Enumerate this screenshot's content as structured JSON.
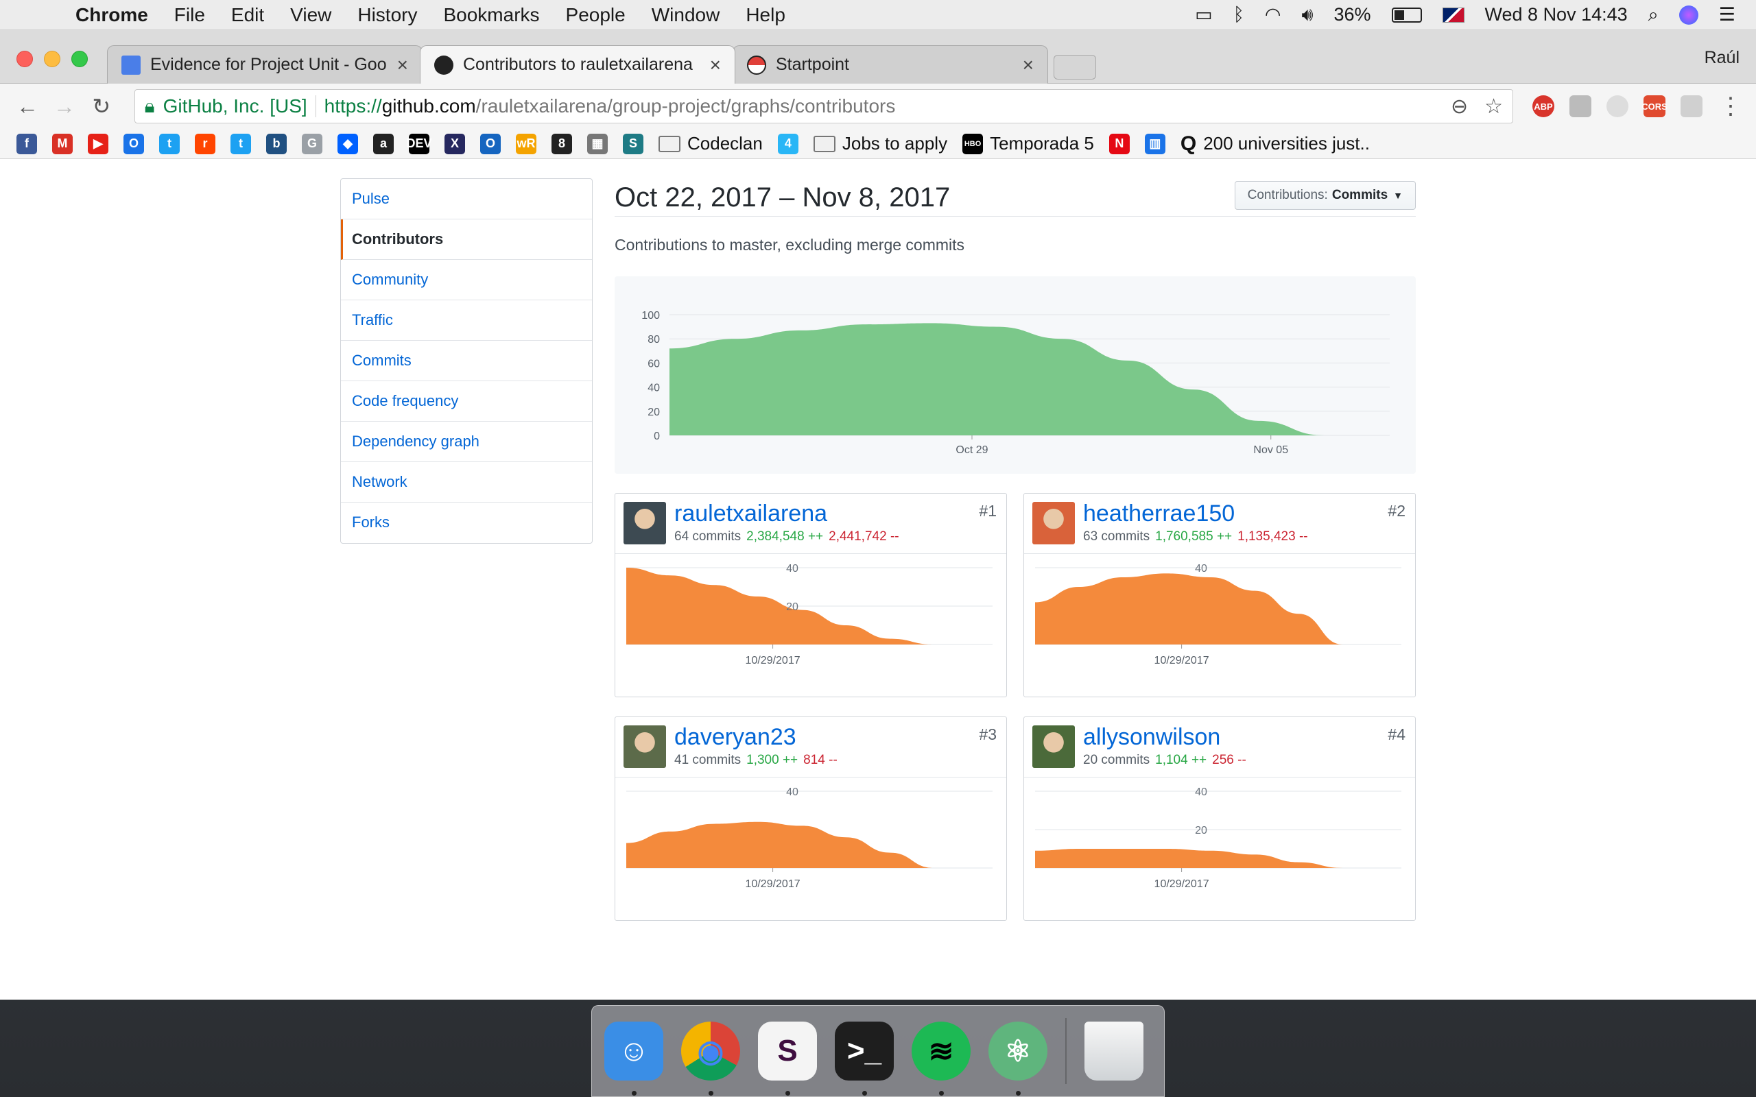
{
  "menubar": {
    "app": "Chrome",
    "items": [
      "File",
      "Edit",
      "View",
      "History",
      "Bookmarks",
      "People",
      "Window",
      "Help"
    ],
    "battery": "36%",
    "datetime": "Wed 8 Nov  14:43"
  },
  "tabs": [
    {
      "title": "Evidence for Project Unit - Goo",
      "favicon_color": "#4a7ee8"
    },
    {
      "title": "Contributors to rauletxailarena",
      "favicon_color": "#222222"
    },
    {
      "title": "Startpoint",
      "favicon_color": "#e0403a"
    }
  ],
  "profile": "Raúl",
  "omnibox": {
    "org": "GitHub, Inc. [US]",
    "scheme": "https://",
    "host": "github.com",
    "path": "/rauletxailarena/group-project/graphs/contributors"
  },
  "extensions": [
    "ABP",
    "",
    "",
    "CORS",
    ""
  ],
  "bookmarks": {
    "icons": [
      {
        "name": "facebook-icon",
        "glyph": "f",
        "color": "#3b5998"
      },
      {
        "name": "gmail-icon",
        "glyph": "M",
        "color": "#d93025"
      },
      {
        "name": "youtube-icon",
        "glyph": "▶",
        "color": "#e62117"
      },
      {
        "name": "opera-icon",
        "glyph": "O",
        "color": "#1a73e8"
      },
      {
        "name": "twitter-icon",
        "glyph": "t",
        "color": "#1da1f2"
      },
      {
        "name": "reddit-icon",
        "glyph": "r",
        "color": "#ff4500"
      },
      {
        "name": "twitter-icon-2",
        "glyph": "t",
        "color": "#1da1f2"
      },
      {
        "name": "bitbucket-icon",
        "glyph": "b",
        "color": "#205081"
      },
      {
        "name": "grammarly-icon",
        "glyph": "G",
        "color": "#9aa0a6"
      },
      {
        "name": "dropbox-icon",
        "glyph": "◆",
        "color": "#0061ff"
      },
      {
        "name": "amazon-icon",
        "glyph": "a",
        "color": "#222222"
      },
      {
        "name": "dev-icon",
        "glyph": "DEV",
        "color": "#000000"
      },
      {
        "name": "xing-icon",
        "glyph": "X",
        "color": "#26285f"
      },
      {
        "name": "ring-icon",
        "glyph": "O",
        "color": "#1565c0"
      },
      {
        "name": "wordreference-icon",
        "glyph": "wR",
        "color": "#f4a300"
      },
      {
        "name": "eightball-icon",
        "glyph": "8",
        "color": "#222222"
      },
      {
        "name": "grid-icon",
        "glyph": "▦",
        "color": "#777777"
      },
      {
        "name": "scribd-icon",
        "glyph": "S",
        "color": "#1e7b85"
      }
    ],
    "folders": [
      {
        "label": "Codeclan",
        "type": "folder"
      },
      {
        "label": "",
        "type": "icon",
        "glyph": "4",
        "color": "#29b6f6"
      },
      {
        "label": "Jobs to apply",
        "type": "folder"
      },
      {
        "label": "Temporada 5",
        "type": "hbo"
      },
      {
        "label": "",
        "type": "icon",
        "glyph": "N",
        "color": "#e50914"
      },
      {
        "label": "",
        "type": "icon",
        "glyph": "▥",
        "color": "#1a73e8"
      },
      {
        "label": "200 universities just..",
        "type": "quora"
      }
    ]
  },
  "sidenav": [
    "Pulse",
    "Contributors",
    "Community",
    "Traffic",
    "Commits",
    "Code frequency",
    "Dependency graph",
    "Network",
    "Forks"
  ],
  "sidenav_selected": "Contributors",
  "header": {
    "range": "Oct 22, 2017 – Nov 8, 2017",
    "dropdown_prefix": "Contributions:",
    "dropdown_value": "Commits"
  },
  "subtitle": "Contributions to master, excluding merge commits",
  "chart_data": [
    {
      "type": "area",
      "series": [
        {
          "values": [
            72,
            80,
            87,
            92,
            93,
            90,
            80,
            62,
            38,
            12,
            0,
            0
          ]
        }
      ],
      "yticks": [
        0,
        20,
        40,
        60,
        80,
        100
      ],
      "ylim": [
        0,
        100
      ],
      "xticks": [
        "Oct 29",
        "Nov 05"
      ],
      "color": "#7bc88a"
    },
    {
      "type": "area",
      "series": [
        {
          "values": [
            40,
            36,
            31,
            25,
            18,
            10,
            3,
            0
          ]
        }
      ],
      "yticks": [
        20,
        40
      ],
      "ylim": [
        0,
        40
      ],
      "xticks": [
        "10/29/2017"
      ],
      "color": "#f48a3c"
    },
    {
      "type": "area",
      "series": [
        {
          "values": [
            22,
            30,
            35,
            37,
            35,
            28,
            16,
            0
          ]
        }
      ],
      "yticks": [
        40
      ],
      "ylim": [
        0,
        40
      ],
      "xticks": [
        "10/29/2017"
      ],
      "color": "#f48a3c"
    },
    {
      "type": "area",
      "series": [
        {
          "values": [
            13,
            19,
            23,
            24,
            22,
            16,
            8,
            0
          ]
        }
      ],
      "yticks": [
        40
      ],
      "ylim": [
        0,
        40
      ],
      "xticks": [
        "10/29/2017"
      ],
      "color": "#f48a3c"
    },
    {
      "type": "area",
      "series": [
        {
          "values": [
            9,
            10,
            10,
            10,
            9,
            7,
            3,
            0
          ]
        }
      ],
      "yticks": [
        20,
        40
      ],
      "ylim": [
        0,
        40
      ],
      "xticks": [
        "10/29/2017"
      ],
      "color": "#f48a3c"
    }
  ],
  "contributors": [
    {
      "login": "rauletxailarena",
      "commits": "64 commits",
      "additions": "2,384,548 ++",
      "deletions": "2,441,742 --",
      "rank": "#1",
      "avatar_color": "#3d4a52"
    },
    {
      "login": "heatherrae150",
      "commits": "63 commits",
      "additions": "1,760,585 ++",
      "deletions": "1,135,423 --",
      "rank": "#2",
      "avatar_color": "#d9623a"
    },
    {
      "login": "daveryan23",
      "commits": "41 commits",
      "additions": "1,300 ++",
      "deletions": "814 --",
      "rank": "#3",
      "avatar_color": "#5c6b4a"
    },
    {
      "login": "allysonwilson",
      "commits": "20 commits",
      "additions": "1,104 ++",
      "deletions": "256 --",
      "rank": "#4",
      "avatar_color": "#4b6a3a"
    }
  ],
  "dock": [
    {
      "name": "finder-app",
      "glyph": "☺",
      "color": "#3a8ee6"
    },
    {
      "name": "chrome-app",
      "glyph": "◉",
      "color": "#e0403a"
    },
    {
      "name": "slack-app",
      "glyph": "S",
      "color": "#ffffff"
    },
    {
      "name": "terminal-app",
      "glyph": ">_",
      "color": "#1e1e1e"
    },
    {
      "name": "spotify-app",
      "glyph": "≋",
      "color": "#1db954"
    },
    {
      "name": "atom-app",
      "glyph": "⚛",
      "color": "#5fb57d"
    }
  ]
}
